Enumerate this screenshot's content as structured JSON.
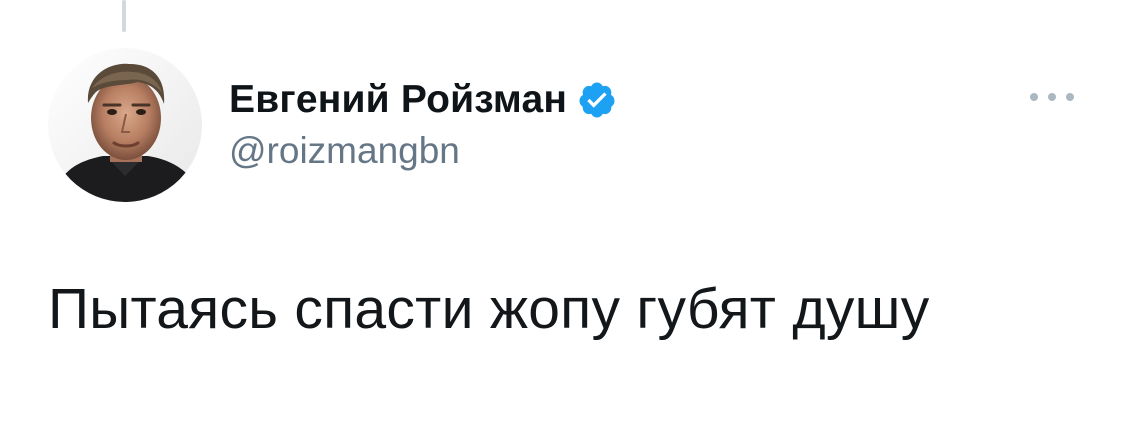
{
  "tweet": {
    "author": {
      "display_name": "Евгений Ройзман",
      "handle": "@roizmangbn",
      "verified": true,
      "avatar_icon": "profile-photo"
    },
    "text": "Пытаясь спасти жопу губят душу",
    "more_icon": "more-dots-icon"
  },
  "colors": {
    "name": "#0f1419",
    "handle": "#657786",
    "text": "#14171a",
    "verified_badge": "#1da1f2",
    "thread_line": "#cfd9de",
    "more_dots": "#aab8c2"
  }
}
